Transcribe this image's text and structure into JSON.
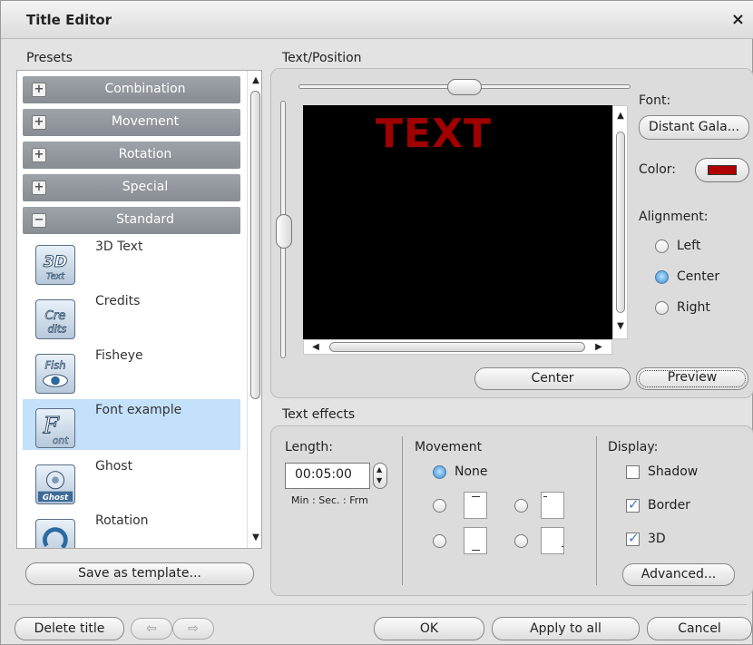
{
  "window": {
    "title": "Title Editor",
    "close_glyph": "×"
  },
  "presets": {
    "label": "Presets",
    "categories": [
      {
        "label": "Combination",
        "toggle": "+"
      },
      {
        "label": "Movement",
        "toggle": "+"
      },
      {
        "label": "Rotation",
        "toggle": "+"
      },
      {
        "label": "Special",
        "toggle": "+"
      },
      {
        "label": "Standard",
        "toggle": "−"
      }
    ],
    "items": [
      {
        "label": "3D Text",
        "icon": "3d-text-icon",
        "icon_text": "3D"
      },
      {
        "label": "Credits",
        "icon": "credits-icon",
        "icon_text": "Cre"
      },
      {
        "label": "Fisheye",
        "icon": "fisheye-icon",
        "icon_text": "Fish"
      },
      {
        "label": "Font example",
        "icon": "font-example-icon",
        "icon_text": "F"
      },
      {
        "label": "Ghost",
        "icon": "ghost-icon",
        "icon_text": "Ghost"
      },
      {
        "label": "Rotation",
        "icon": "rotation-icon",
        "icon_text": ""
      }
    ],
    "selected": "Font example",
    "save_button": "Save as template..."
  },
  "text_position": {
    "label": "Text/Position",
    "preview_text": "TEXT",
    "text_color": "#a00000",
    "center_button": "Center",
    "preview_button": "Preview",
    "font_label": "Font:",
    "font_value": "Distant Gala...",
    "color_label": "Color:",
    "color_swatch": "#b00000",
    "alignment_label": "Alignment:",
    "alignment": {
      "left": "Left",
      "center": "Center",
      "right": "Right",
      "selected": "Center"
    }
  },
  "text_effects": {
    "label": "Text effects",
    "length_label": "Length:",
    "length_value": "00:05:00",
    "length_hint": "Min : Sec. : Frm",
    "movement_label": "Movement",
    "movement_none": "None",
    "display_label": "Display:",
    "shadow_label": "Shadow",
    "border_label": "Border",
    "three_d_label": "3D",
    "shadow_checked": false,
    "border_checked": true,
    "three_d_checked": true,
    "advanced_button": "Advanced..."
  },
  "footer": {
    "delete_button": "Delete title",
    "ok_button": "OK",
    "apply_button": "Apply to all",
    "cancel_button": "Cancel"
  }
}
